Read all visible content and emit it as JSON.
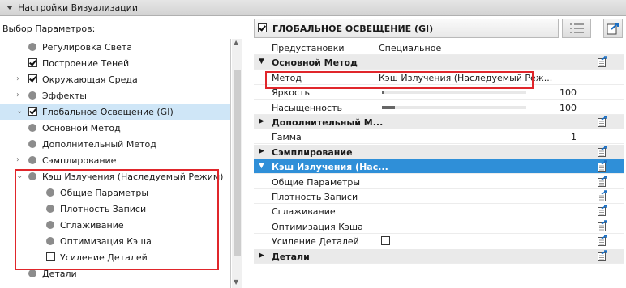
{
  "title": "Настройки Визуализации",
  "left": {
    "label": "Выбор Параметров:",
    "tree": [
      {
        "label": "Регулировка Света",
        "kind": "bullet",
        "indent": 1
      },
      {
        "label": "Построение Теней",
        "kind": "checkbox",
        "checked": true,
        "indent": 1
      },
      {
        "label": "Окружающая Среда",
        "kind": "checkbox",
        "checked": true,
        "indent": 1,
        "chevron": "right"
      },
      {
        "label": "Эффекты",
        "kind": "bullet",
        "indent": 1,
        "chevron": "right"
      },
      {
        "label": "Глобальное Освещение (GI)",
        "kind": "checkbox",
        "checked": true,
        "indent": 1,
        "chevron": "down",
        "selected": true
      },
      {
        "label": "Основной Метод",
        "kind": "bullet",
        "indent": 2
      },
      {
        "label": "Дополнительный Метод",
        "kind": "bullet",
        "indent": 2
      },
      {
        "label": "Сэмплирование",
        "kind": "bullet",
        "indent": 2,
        "chevron": "right"
      },
      {
        "label": "Кэш Излучения (Наследуемый Режим)",
        "kind": "bullet",
        "indent": 2,
        "chevron": "down"
      },
      {
        "label": "Общие Параметры",
        "kind": "bullet",
        "indent": 3
      },
      {
        "label": "Плотность Записи",
        "kind": "bullet",
        "indent": 3
      },
      {
        "label": "Сглаживание",
        "kind": "bullet",
        "indent": 3
      },
      {
        "label": "Оптимизация Кэша",
        "kind": "bullet",
        "indent": 3
      },
      {
        "label": "Усиление Деталей",
        "kind": "checkbox",
        "checked": false,
        "indent": 3
      },
      {
        "label": "Детали",
        "kind": "bullet",
        "indent": 2
      }
    ]
  },
  "right": {
    "header": "ГЛОБАЛЬНОЕ ОСВЕЩЕНИЕ (GI)",
    "rows": [
      {
        "type": "prop",
        "key": "Предустановки",
        "value": "Специальное"
      },
      {
        "type": "section",
        "key": "Основной Метод",
        "icon": true
      },
      {
        "type": "prop",
        "key": "Метод",
        "value": "Кэш Излучения (Наследуемый Реж..."
      },
      {
        "type": "slider",
        "key": "Яркость",
        "level": 100,
        "num": "100"
      },
      {
        "type": "slider",
        "key": "Насыщенность",
        "level": 100,
        "num": "100"
      },
      {
        "type": "section",
        "key": "Дополнительный М...",
        "icon": true
      },
      {
        "type": "prop",
        "key": "Гамма",
        "value": "",
        "num": "1"
      },
      {
        "type": "section",
        "key": "Сэмплирование",
        "icon": true
      },
      {
        "type": "section",
        "key": "Кэш Излучения (Нас...",
        "icon": true,
        "selected": true
      },
      {
        "type": "prop",
        "key": "Общие Параметры",
        "value": "",
        "icon": true
      },
      {
        "type": "prop",
        "key": "Плотность Записи",
        "value": "",
        "icon": true
      },
      {
        "type": "prop",
        "key": "Сглаживание",
        "value": "",
        "icon": true
      },
      {
        "type": "prop",
        "key": "Оптимизация Кэша",
        "value": "",
        "icon": true
      },
      {
        "type": "check",
        "key": "Усиление Деталей",
        "checked": false,
        "icon": true
      },
      {
        "type": "section",
        "key": "Детали",
        "icon": true
      }
    ]
  },
  "colors": {
    "selected": "#cfe6f7",
    "section_selected": "#2f8fd8",
    "highlight": "#e0262b"
  }
}
